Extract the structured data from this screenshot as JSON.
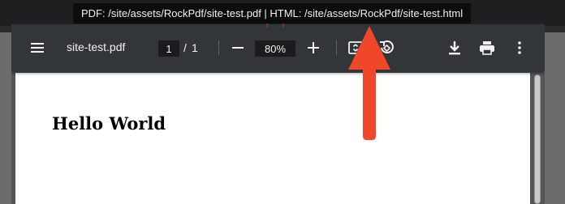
{
  "tooltip": {
    "text": "PDF: /site/assets/RockPdf/site-test.pdf | HTML: /site/assets/RockPdf/site-test.html"
  },
  "toolbar": {
    "title": "site-test.pdf",
    "page_current": "1",
    "page_separator": "/",
    "page_total": "1",
    "zoom_out_icon": "minus-icon",
    "zoom_value": "80%",
    "zoom_in_icon": "plus-icon",
    "icons": [
      "menu-icon",
      "fit-to-page-icon",
      "rotate-icon",
      "download-icon",
      "print-icon",
      "more-vert-icon"
    ]
  },
  "document": {
    "heading": "Hello World"
  },
  "annotation": {
    "arrow_color": "#f0472a"
  }
}
